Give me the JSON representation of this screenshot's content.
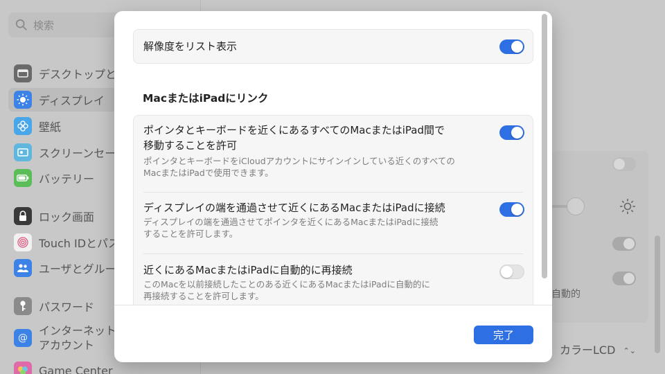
{
  "background": {
    "search_placeholder": "検索",
    "sidebar_items": [
      {
        "label": "デスクトップと",
        "icon": "desktop-icon",
        "color": "#6a6a6a"
      },
      {
        "label": "ディスプレイ",
        "icon": "display-sun-icon",
        "color": "#3d82e6"
      },
      {
        "label": "壁紙",
        "icon": "wallpaper-flower-icon",
        "color": "#49a6e8"
      },
      {
        "label": "スクリーンセー",
        "icon": "screensaver-icon",
        "color": "#5fb7de"
      },
      {
        "label": "バッテリー",
        "icon": "battery-icon",
        "color": "#5bbd57"
      },
      {
        "label": "ロック画面",
        "icon": "lock-icon",
        "color": "#3a3a3a"
      },
      {
        "label": "Touch IDとパス",
        "icon": "fingerprint-icon",
        "color": "#f1f1f1"
      },
      {
        "label": "ユーザとグルー",
        "icon": "users-icon",
        "color": "#3d82e6"
      },
      {
        "label": "パスワード",
        "icon": "key-icon",
        "color": "#8a8a8a"
      },
      {
        "label_line1": "インターネット",
        "label_line2": "アカウント",
        "icon": "at-icon",
        "color": "#3d82e6"
      },
      {
        "label": "Game Center",
        "icon": "game-center-icon",
        "color": "#e06aa8"
      }
    ],
    "right_partial_text": "自動的",
    "color_profile": "カラーLCD",
    "color_profile_chevron": "⌃⌄"
  },
  "sheet": {
    "top_row": {
      "label": "解像度をリスト表示",
      "toggle_on": true
    },
    "section_title": "MacまたはiPadにリンク",
    "rows": [
      {
        "title": "ポインタとキーボードを近くにあるすべてのMacまたはiPad間で移動することを許可",
        "title_line1": "ポインタとキーボードを近くにあるすべてのMacまたはiPad間で",
        "title_line2": "移動することを許可",
        "desc_line1": "ポインタとキーボードをiCloudアカウントにサインインしている近くのすべての",
        "desc_line2": "MacまたはiPadで使用できます。",
        "toggle_on": true
      },
      {
        "title_line1": "ディスプレイの端を通過させて近くにあるMacまたはiPadに接続",
        "desc_line1": "ディスプレイの端を通過させてポインタを近くにあるMacまたはiPadに接続",
        "desc_line2": "することを許可します。",
        "toggle_on": true
      },
      {
        "title_line1": "近くにあるMacまたはiPadに自動的に再接続",
        "desc_line1": "このMacを以前接続したことのある近くにあるMacまたはiPadに自動的に",
        "desc_line2": "再接続することを許可します。",
        "toggle_on": false
      }
    ],
    "done_label": "完了"
  },
  "colors": {
    "accent": "#2f6fe4",
    "toggle_off": "#e4e4e4"
  }
}
